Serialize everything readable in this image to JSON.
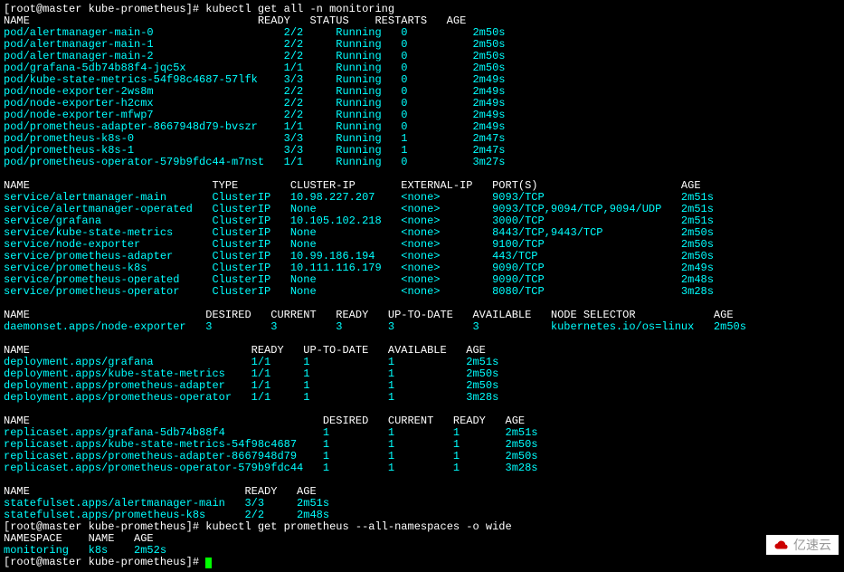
{
  "prompt1_user": "[root@master kube-prometheus]# ",
  "cmd1": "kubectl get all -n monitoring",
  "pods": {
    "header": "NAME                                   READY   STATUS    RESTARTS   AGE",
    "rows": [
      [
        "pod/alertmanager-main-0                    2/2     Running   0          2m50s"
      ],
      [
        "pod/alertmanager-main-1                    2/2     Running   0          2m50s"
      ],
      [
        "pod/alertmanager-main-2                    2/2     Running   0          2m50s"
      ],
      [
        "pod/grafana-5db74b88f4-jqc5x               1/1     Running   0          2m50s"
      ],
      [
        "pod/kube-state-metrics-54f98c4687-57lfk    3/3     Running   0          2m49s"
      ],
      [
        "pod/node-exporter-2ws8m                    2/2     Running   0          2m49s"
      ],
      [
        "pod/node-exporter-h2cmx                    2/2     Running   0          2m49s"
      ],
      [
        "pod/node-exporter-mfwp7                    2/2     Running   0          2m49s"
      ],
      [
        "pod/prometheus-adapter-8667948d79-bvszr    1/1     Running   0          2m49s"
      ],
      [
        "pod/prometheus-k8s-0                       3/3     Running   1          2m47s"
      ],
      [
        "pod/prometheus-k8s-1                       3/3     Running   1          2m47s"
      ],
      [
        "pod/prometheus-operator-579b9fdc44-m7nst   1/1     Running   0          3m27s"
      ]
    ]
  },
  "services": {
    "header": "NAME                            TYPE        CLUSTER-IP       EXTERNAL-IP   PORT(S)                      AGE",
    "rows": [
      [
        "service/alertmanager-main       ClusterIP   10.98.227.207    <none>        9093/TCP                     2m51s"
      ],
      [
        "service/alertmanager-operated   ClusterIP   None             <none>        9093/TCP,9094/TCP,9094/UDP   2m51s"
      ],
      [
        "service/grafana                 ClusterIP   10.105.102.218   <none>        3000/TCP                     2m51s"
      ],
      [
        "service/kube-state-metrics      ClusterIP   None             <none>        8443/TCP,9443/TCP            2m50s"
      ],
      [
        "service/node-exporter           ClusterIP   None             <none>        9100/TCP                     2m50s"
      ],
      [
        "service/prometheus-adapter      ClusterIP   10.99.186.194    <none>        443/TCP                      2m50s"
      ],
      [
        "service/prometheus-k8s          ClusterIP   10.111.116.179   <none>        9090/TCP                     2m49s"
      ],
      [
        "service/prometheus-operated     ClusterIP   None             <none>        9090/TCP                     2m48s"
      ],
      [
        "service/prometheus-operator     ClusterIP   None             <none>        8080/TCP                     3m28s"
      ]
    ]
  },
  "daemonset": {
    "header": "NAME                           DESIRED   CURRENT   READY   UP-TO-DATE   AVAILABLE   NODE SELECTOR            AGE",
    "rows": [
      [
        "daemonset.apps/node-exporter   3         3         3       3            3           kubernetes.io/os=linux   2m50s"
      ]
    ]
  },
  "deployments": {
    "header": "NAME                                  READY   UP-TO-DATE   AVAILABLE   AGE",
    "rows": [
      [
        "deployment.apps/grafana               1/1     1            1           2m51s"
      ],
      [
        "deployment.apps/kube-state-metrics    1/1     1            1           2m50s"
      ],
      [
        "deployment.apps/prometheus-adapter    1/1     1            1           2m50s"
      ],
      [
        "deployment.apps/prometheus-operator   1/1     1            1           3m28s"
      ]
    ]
  },
  "replicasets": {
    "header": "NAME                                             DESIRED   CURRENT   READY   AGE",
    "rows": [
      [
        "replicaset.apps/grafana-5db74b88f4               1         1         1       2m51s"
      ],
      [
        "replicaset.apps/kube-state-metrics-54f98c4687    1         1         1       2m50s"
      ],
      [
        "replicaset.apps/prometheus-adapter-8667948d79    1         1         1       2m50s"
      ],
      [
        "replicaset.apps/prometheus-operator-579b9fdc44   1         1         1       3m28s"
      ]
    ]
  },
  "statefulsets": {
    "header": "NAME                                 READY   AGE",
    "rows": [
      [
        "statefulset.apps/alertmanager-main   3/3     2m51s"
      ],
      [
        "statefulset.apps/prometheus-k8s      2/2     2m48s"
      ]
    ]
  },
  "prompt2_user": "[root@master kube-prometheus]# ",
  "cmd2": "kubectl get prometheus --all-namespaces -o wide",
  "prom": {
    "header": "NAMESPACE    NAME   AGE",
    "rows": [
      [
        "monitoring   k8s    2m52s"
      ]
    ]
  },
  "prompt3_user": "[root@master kube-prometheus]# ",
  "watermark": "亿速云"
}
